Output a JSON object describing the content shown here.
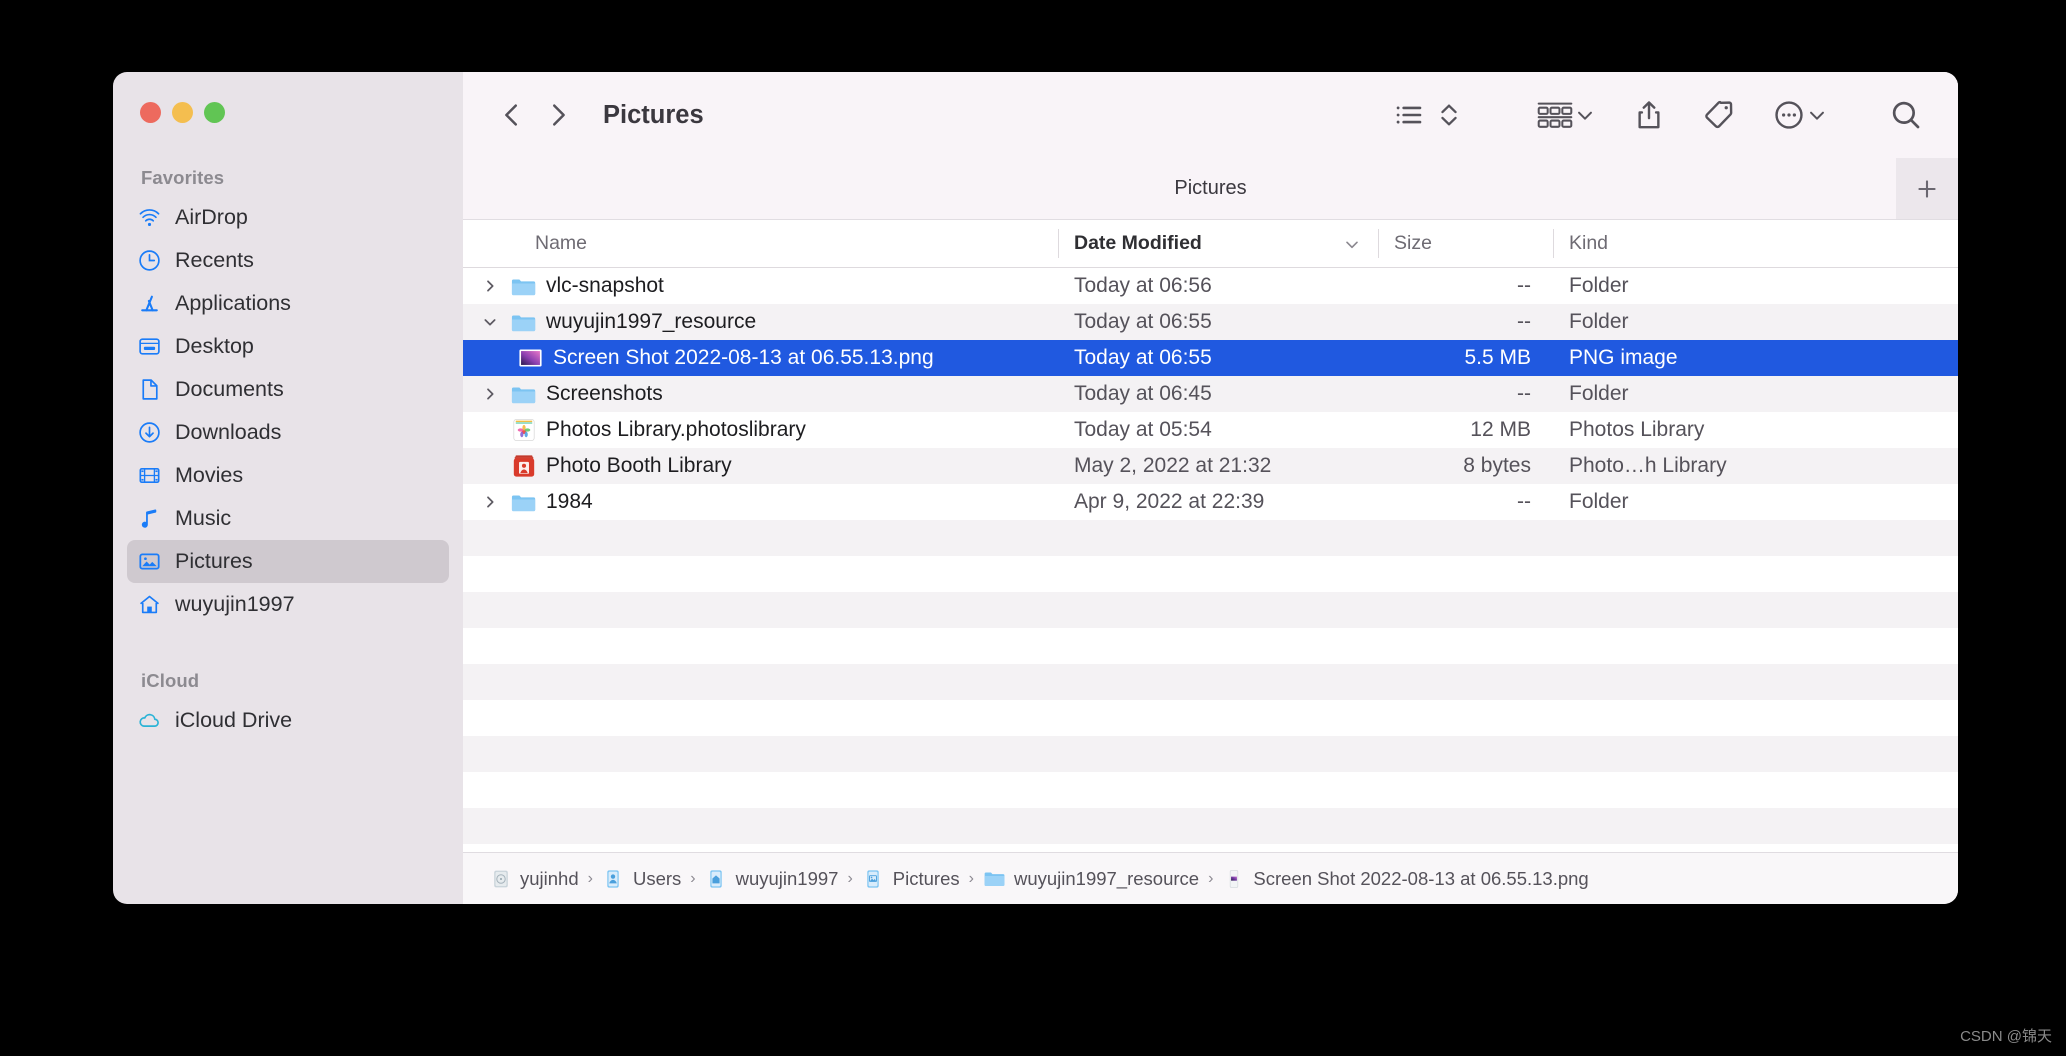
{
  "window": {
    "traffic_lights": [
      "close",
      "minimize",
      "maximize"
    ],
    "colors": {
      "close": "#ED6A5E",
      "minimize": "#F4BE4F",
      "maximize": "#61C554",
      "selection_blue": "#2059E0",
      "sidebar_bg": "#E8E3E8",
      "toolbar_bg": "#F9F4F8",
      "sidebar_selected": "#CFC9CF",
      "accent_icon_blue": "#1A7CF8"
    }
  },
  "toolbar": {
    "back_label": "Back",
    "forward_label": "Forward",
    "folder_title": "Pictures",
    "view_list_label": "List View",
    "sort_label": "Sort",
    "group_label": "Group",
    "share_label": "Share",
    "tag_label": "Tags",
    "more_label": "More",
    "search_label": "Search"
  },
  "tabbar": {
    "active_tab": "Pictures",
    "new_tab_label": "+"
  },
  "columns": [
    {
      "key": "name",
      "label": "Name",
      "sorted": false
    },
    {
      "key": "date",
      "label": "Date Modified",
      "sorted": true
    },
    {
      "key": "size",
      "label": "Size",
      "sorted": false
    },
    {
      "key": "kind",
      "label": "Kind",
      "sorted": false
    }
  ],
  "rows": [
    {
      "name": "vlc-snapshot",
      "date": "Today at 06:56",
      "size": "--",
      "kind": "Folder",
      "icon": "folder-icon",
      "disclosure": "closed",
      "indent": 0,
      "selected": false,
      "striped": false
    },
    {
      "name": "wuyujin1997_resource",
      "date": "Today at 06:55",
      "size": "--",
      "kind": "Folder",
      "icon": "folder-icon",
      "disclosure": "open",
      "indent": 0,
      "selected": false,
      "striped": true
    },
    {
      "name": "Screen Shot 2022-08-13 at 06.55.13.png",
      "date": "Today at 06:55",
      "size": "5.5 MB",
      "kind": "PNG image",
      "icon": "png-image-icon",
      "disclosure": "none",
      "indent": 1,
      "selected": true,
      "striped": false
    },
    {
      "name": "Screenshots",
      "date": "Today at 06:45",
      "size": "--",
      "kind": "Folder",
      "icon": "folder-icon",
      "disclosure": "closed",
      "indent": 0,
      "selected": false,
      "striped": true
    },
    {
      "name": "Photos Library.photoslibrary",
      "date": "Today at 05:54",
      "size": "12 MB",
      "kind": "Photos Library",
      "icon": "photos-library-icon",
      "disclosure": "none",
      "indent": 0,
      "selected": false,
      "striped": false
    },
    {
      "name": "Photo Booth Library",
      "date": "May 2, 2022 at 21:32",
      "size": "8 bytes",
      "kind": "Photo…h Library",
      "icon": "photo-booth-library-icon",
      "disclosure": "none",
      "indent": 0,
      "selected": false,
      "striped": true
    },
    {
      "name": "1984",
      "date": "Apr 9, 2022 at 22:39",
      "size": "--",
      "kind": "Folder",
      "icon": "folder-icon",
      "disclosure": "closed",
      "indent": 0,
      "selected": false,
      "striped": false
    }
  ],
  "sidebar": {
    "sections": [
      {
        "title": "Favorites",
        "items": [
          {
            "label": "AirDrop",
            "icon": "airdrop-icon",
            "selected": false
          },
          {
            "label": "Recents",
            "icon": "clock-icon",
            "selected": false
          },
          {
            "label": "Applications",
            "icon": "applications-icon",
            "selected": false
          },
          {
            "label": "Desktop",
            "icon": "desktop-icon",
            "selected": false
          },
          {
            "label": "Documents",
            "icon": "document-icon",
            "selected": false
          },
          {
            "label": "Downloads",
            "icon": "download-icon",
            "selected": false
          },
          {
            "label": "Movies",
            "icon": "film-icon",
            "selected": false
          },
          {
            "label": "Music",
            "icon": "music-note-icon",
            "selected": false
          },
          {
            "label": "Pictures",
            "icon": "pictures-icon",
            "selected": true
          },
          {
            "label": "wuyujin1997",
            "icon": "home-icon",
            "selected": false
          }
        ]
      },
      {
        "title": "iCloud",
        "items": [
          {
            "label": "iCloud Drive",
            "icon": "cloud-icon",
            "selected": false
          }
        ]
      }
    ]
  },
  "pathbar": {
    "crumbs": [
      {
        "label": "yujinhd",
        "icon": "hard-disk-icon"
      },
      {
        "label": "Users",
        "icon": "users-folder-icon"
      },
      {
        "label": "wuyujin1997",
        "icon": "home-folder-icon"
      },
      {
        "label": "Pictures",
        "icon": "pictures-folder-icon"
      },
      {
        "label": "wuyujin1997_resource",
        "icon": "folder-icon"
      },
      {
        "label": "Screen Shot 2022-08-13 at 06.55.13.png",
        "icon": "png-image-icon"
      }
    ],
    "separator": "›"
  },
  "watermark": {
    "text": "CSDN @锦天"
  }
}
